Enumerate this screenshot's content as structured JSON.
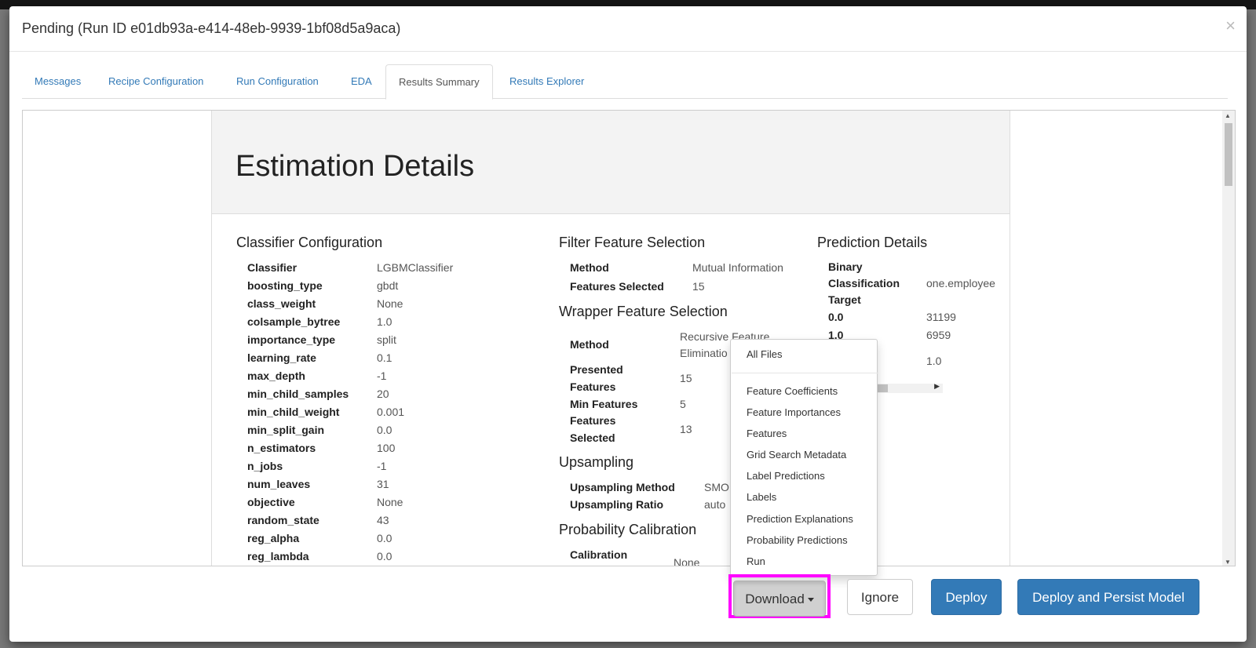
{
  "modal": {
    "title": "Pending (Run ID e01db93a-e414-48eb-9939-1bf08d5a9aca)",
    "close": "×"
  },
  "tabs": [
    {
      "label": "Messages",
      "active": false
    },
    {
      "label": "Recipe Configuration",
      "active": false
    },
    {
      "label": "Run Configuration",
      "active": false
    },
    {
      "label": "EDA",
      "active": false
    },
    {
      "label": "Results Summary",
      "active": true
    },
    {
      "label": "Results Explorer",
      "active": false
    }
  ],
  "report": {
    "title": "Estimation Details",
    "classifier": {
      "heading": "Classifier Configuration",
      "rows": [
        {
          "k": "Classifier",
          "v": "LGBMClassifier"
        },
        {
          "k": "boosting_type",
          "v": "gbdt"
        },
        {
          "k": "class_weight",
          "v": "None"
        },
        {
          "k": "colsample_bytree",
          "v": "1.0"
        },
        {
          "k": "importance_type",
          "v": "split"
        },
        {
          "k": "learning_rate",
          "v": "0.1"
        },
        {
          "k": "max_depth",
          "v": "-1"
        },
        {
          "k": "min_child_samples",
          "v": "20"
        },
        {
          "k": "min_child_weight",
          "v": "0.001"
        },
        {
          "k": "min_split_gain",
          "v": "0.0"
        },
        {
          "k": "n_estimators",
          "v": "100"
        },
        {
          "k": "n_jobs",
          "v": "-1"
        },
        {
          "k": "num_leaves",
          "v": "31"
        },
        {
          "k": "objective",
          "v": "None"
        },
        {
          "k": "random_state",
          "v": "43"
        },
        {
          "k": "reg_alpha",
          "v": "0.0"
        },
        {
          "k": "reg_lambda",
          "v": "0.0"
        }
      ]
    },
    "filter": {
      "heading": "Filter Feature Selection",
      "method_k": "Method",
      "method_v": "Mutual Information",
      "selected_k": "Features Selected",
      "selected_v": "15"
    },
    "wrapper": {
      "heading": "Wrapper Feature Selection",
      "method_k": "Method",
      "method_v1": "Recursive Feature",
      "method_v2": "Eliminatio",
      "presented_k1": "Presented",
      "presented_k2": "Features",
      "presented_v": "15",
      "min_k": "Min Features",
      "min_v": "5",
      "selected_k1": "Features",
      "selected_k2": "Selected",
      "selected_v": "13"
    },
    "upsampling": {
      "heading": "Upsampling",
      "method_k": "Upsampling Method",
      "method_v": "SMO",
      "ratio_k": "Upsampling Ratio",
      "ratio_v": "auto"
    },
    "calibration": {
      "heading": "Probability Calibration",
      "k": "Calibration",
      "v": "None"
    },
    "prediction": {
      "heading": "Prediction Details",
      "target_k1": "Binary",
      "target_k2": "Classification",
      "target_k3": "Target",
      "target_v": "one.employee",
      "r0_k": "0.0",
      "r0_v": "31199",
      "r1_k": "1.0",
      "r1_v": "6959",
      "r2_v": "1.0"
    }
  },
  "dropdown": {
    "items": [
      "All Files",
      "Feature Coefficients",
      "Feature Importances",
      "Features",
      "Grid Search Metadata",
      "Label Predictions",
      "Labels",
      "Prediction Explanations",
      "Probability Predictions",
      "Run"
    ]
  },
  "footer": {
    "download": "Download",
    "ignore": "Ignore",
    "deploy": "Deploy",
    "deploy_persist": "Deploy and Persist Model"
  },
  "colors": {
    "primary": "#337ab7",
    "highlight": "#ff00ff"
  }
}
